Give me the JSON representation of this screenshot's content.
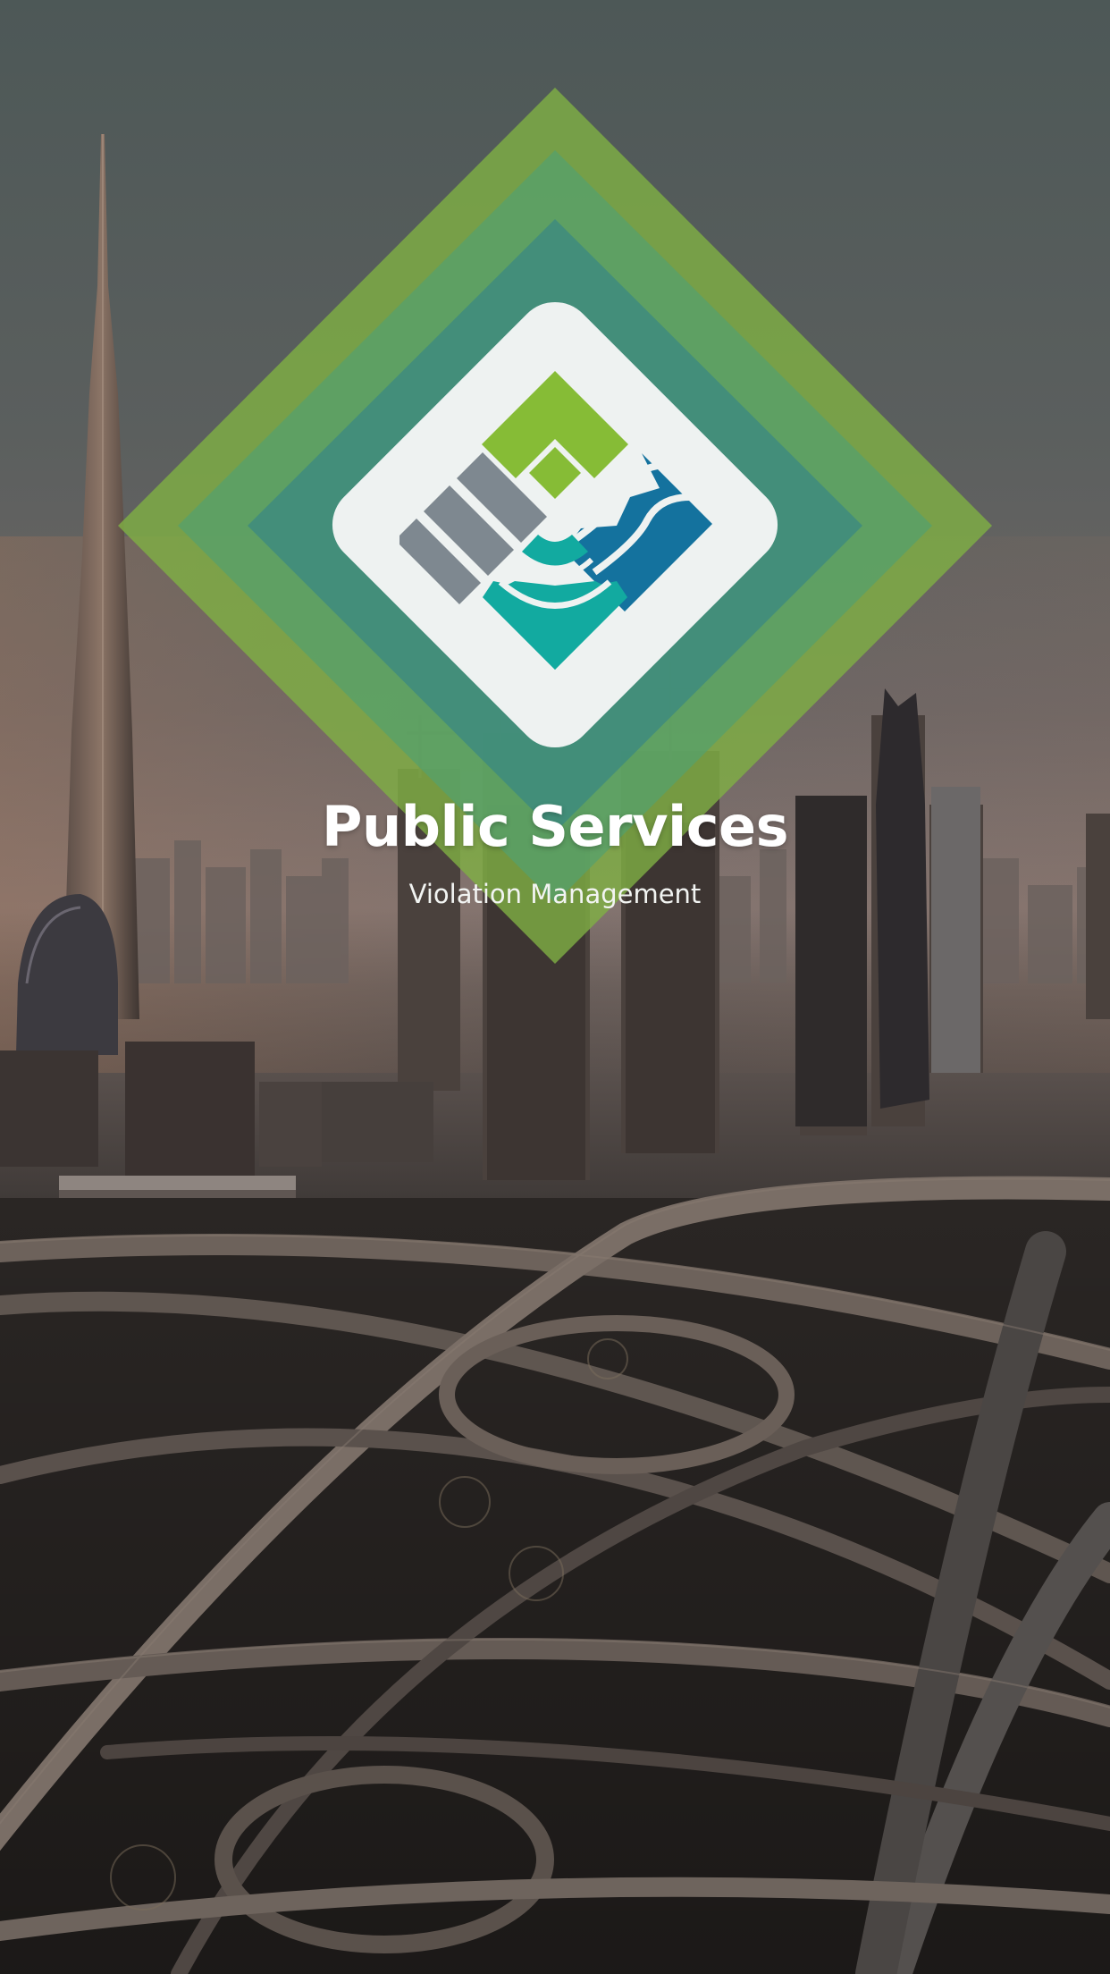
{
  "app": {
    "title": "Public Services",
    "subtitle": "Violation Management"
  },
  "background": {
    "scene": "city skyline with highway interchange",
    "sky_top": "#4e5a59",
    "sky_mid": "#6b6565",
    "horizon": "#8a7a76",
    "ground": "#2a2725"
  },
  "logo": {
    "icon_name": "public-services-logo-icon",
    "colors": {
      "outer_ring": "#7fb043",
      "middle_ring": "#59a06a",
      "inner_ring": "#3e8a80",
      "tile": "#eef2f1",
      "green": "#86bc36",
      "gray": "#7e8890",
      "blue": "#14729e",
      "teal": "#12aaa0"
    }
  }
}
